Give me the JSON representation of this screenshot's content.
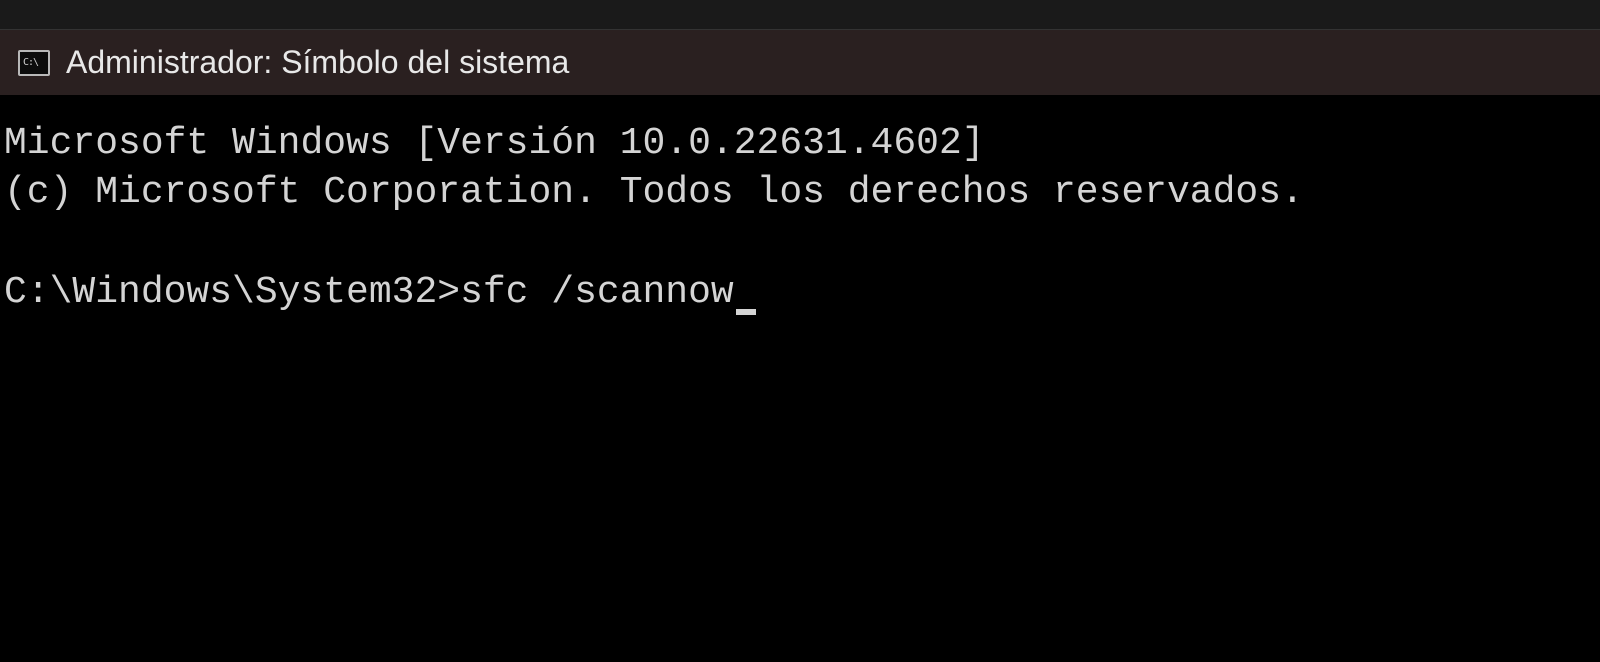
{
  "window": {
    "tab_title": "Administrador: Símbolo del sistema"
  },
  "terminal": {
    "banner_line1": "Microsoft Windows [Versión 10.0.22631.4602]",
    "banner_line2": "(c) Microsoft Corporation. Todos los derechos reservados.",
    "prompt": "C:\\Windows\\System32>",
    "command": "sfc /scannow"
  }
}
